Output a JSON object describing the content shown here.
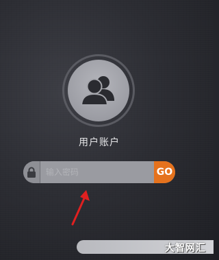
{
  "account": {
    "label": "用户账户"
  },
  "login": {
    "password_placeholder": "输入密码",
    "go_label": "GO"
  },
  "icons": {
    "avatar": "users-icon",
    "lock": "lock-icon",
    "arrow": "arrow-annotation"
  },
  "colors": {
    "accent": "#e5721d",
    "annotation": "#e02020"
  },
  "watermark": {
    "text": "大智网汇"
  }
}
